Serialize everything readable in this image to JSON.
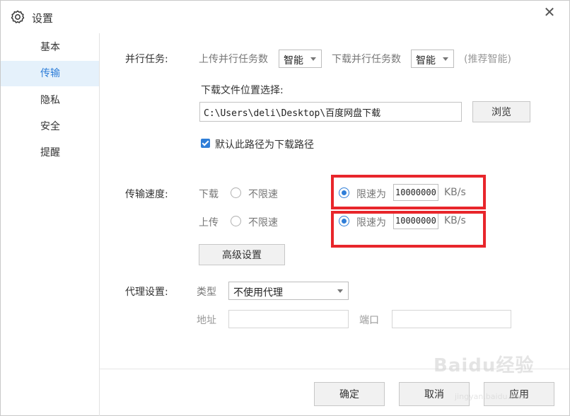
{
  "window": {
    "title": "设置",
    "close_glyph": "✕"
  },
  "sidebar": {
    "items": [
      {
        "label": "基本"
      },
      {
        "label": "传输"
      },
      {
        "label": "隐私"
      },
      {
        "label": "安全"
      },
      {
        "label": "提醒"
      }
    ],
    "active_index": 1
  },
  "parallel": {
    "section_label": "并行任务:",
    "upload_label": "上传并行任务数",
    "upload_value": "智能",
    "download_label": "下载并行任务数",
    "download_value": "智能",
    "hint": "(推荐智能)"
  },
  "download_location": {
    "label": "下载文件位置选择:",
    "path": "C:\\Users\\deli\\Desktop\\百度网盘下载",
    "browse_label": "浏览",
    "default_checked": true,
    "default_label": "默认此路径为下载路径"
  },
  "speed": {
    "section_label": "传输速度:",
    "download_label": "下载",
    "upload_label": "上传",
    "unlimited_label": "不限速",
    "limit_label": "限速为",
    "download_limit_value": "10000000",
    "upload_limit_value": "10000000",
    "unit": "KB/s",
    "download_mode": "limit",
    "upload_mode": "limit",
    "advanced_label": "高级设置"
  },
  "proxy": {
    "section_label": "代理设置:",
    "type_label": "类型",
    "type_value": "不使用代理",
    "address_label": "地址",
    "address_value": "",
    "port_label": "端口",
    "port_value": ""
  },
  "footer": {
    "ok_label": "确定",
    "cancel_label": "取消",
    "apply_label": "应用"
  },
  "watermark": {
    "text": "Baidu经验",
    "sub": "jingyan.baidu.com"
  },
  "colors": {
    "accent": "#2f7ed8",
    "highlight_box": "#e8262b",
    "active_nav_bg": "#e5f1fb"
  },
  "icons": {
    "title": "gear-icon",
    "close": "close-icon",
    "dropdown": "chevron-down-icon",
    "checkbox": "check-icon"
  }
}
